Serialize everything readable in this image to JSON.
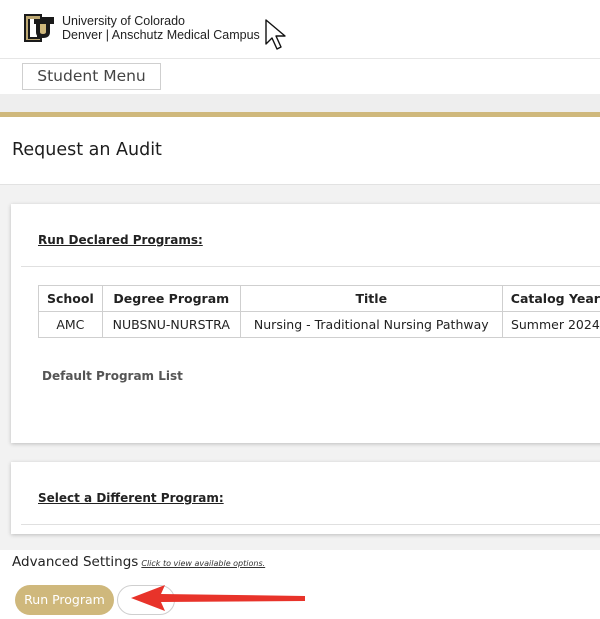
{
  "header": {
    "university_line1": "University of Colorado",
    "university_line2": "Denver | Anschutz Medical Campus"
  },
  "nav": {
    "student_menu_label": "Student Menu"
  },
  "page": {
    "title": "Request an Audit"
  },
  "declared": {
    "heading": "Run Declared Programs:",
    "table": {
      "columns": [
        "School",
        "Degree Program",
        "Title",
        "Catalog Year"
      ],
      "rows": [
        [
          "AMC",
          "NUBSNU-NURSTRA",
          "Nursing - Traditional Nursing Pathway",
          "Summer 2024"
        ]
      ]
    },
    "default_list_link": "Default Program List"
  },
  "different": {
    "heading": "Select a Different Program:"
  },
  "advanced": {
    "label": "Advanced Settings",
    "link": "Click to view available options."
  },
  "actions": {
    "run_program_label": "Run Program"
  },
  "colors": {
    "gold": "#cfb87c",
    "annotation_arrow": "#e8332a"
  },
  "icons": {
    "logo": "cu-logo-icon",
    "cursor": "mouse-cursor-icon",
    "annotation": "red-arrow-annotation"
  }
}
